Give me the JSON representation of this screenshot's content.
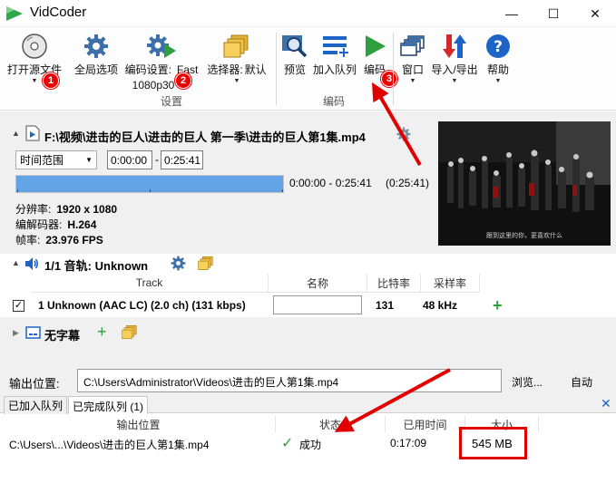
{
  "app": {
    "title": "VidCoder"
  },
  "window_controls": {
    "minimize": "—",
    "maximize": "☐",
    "close": "✕"
  },
  "toolbar": {
    "open_source": "打开源文件",
    "global_options": "全局选项",
    "encoding_settings": "编码设置:",
    "encoding_preset_line1": "Fast",
    "encoding_preset_line2": "1080p30",
    "picker_label": "选择器:",
    "picker_value": "默认",
    "settings_group": "设置",
    "preview": "预览",
    "add_to_queue": "加入队列",
    "encode": "编码",
    "encode_group": "编码",
    "window": "窗口",
    "import_export": "导入/导出",
    "help": "帮助",
    "dropdown_arrow": "▼",
    "badge_1": "1",
    "badge_2": "2",
    "badge_3": "3"
  },
  "source": {
    "path": "F:\\视频\\进击的巨人\\进击的巨人 第一季\\进击的巨人第1集.mp4",
    "range_mode": "时间范围",
    "start_time": "0:00:00",
    "end_time": "0:25:41",
    "range_dash": "-",
    "range_text": "0:00:00 - 0:25:41",
    "duration": "(0:25:41)",
    "progress_fraction": 1.0,
    "resolution_label": "分辨率:",
    "resolution_value": "1920 x 1080",
    "decoder_label": "编解码器:",
    "decoder_value": "H.264",
    "framerate_label": "帧率:",
    "framerate_value": "23.976 FPS",
    "preview_subtitle": "跟到这里的你，更喜欢什么"
  },
  "audio": {
    "header": "1/1 音轨: Unknown",
    "columns": [
      "Track",
      "名称",
      "比特率",
      "采样率"
    ],
    "track": {
      "description": "1 Unknown (AAC LC) (2.0 ch) (131 kbps)",
      "name_value": "",
      "bitrate": "131",
      "samplerate": "48 kHz",
      "add": "+"
    }
  },
  "subtitles": {
    "label": "无字幕",
    "add": "+"
  },
  "output": {
    "label": "输出位置:",
    "path": "C:\\Users\\Administrator\\Videos\\进击的巨人第1集.mp4",
    "browse": "浏览...",
    "auto": "自动"
  },
  "queue": {
    "tabs": [
      "已加入队列",
      "已完成队列 (1)"
    ],
    "close": "✕",
    "columns": [
      "输出位置",
      "状态",
      "已用时间",
      "大小"
    ],
    "rows": [
      {
        "path": "C:\\Users\\...\\Videos\\进击的巨人第1集.mp4",
        "status": "成功",
        "elapsed": "0:17:09",
        "size": "545 MB"
      }
    ]
  },
  "colors": {
    "accent": "#1e63c6",
    "encode_green": "#2e9e3e",
    "highlight_red": "#e00000",
    "progress": "#63a3e6"
  }
}
